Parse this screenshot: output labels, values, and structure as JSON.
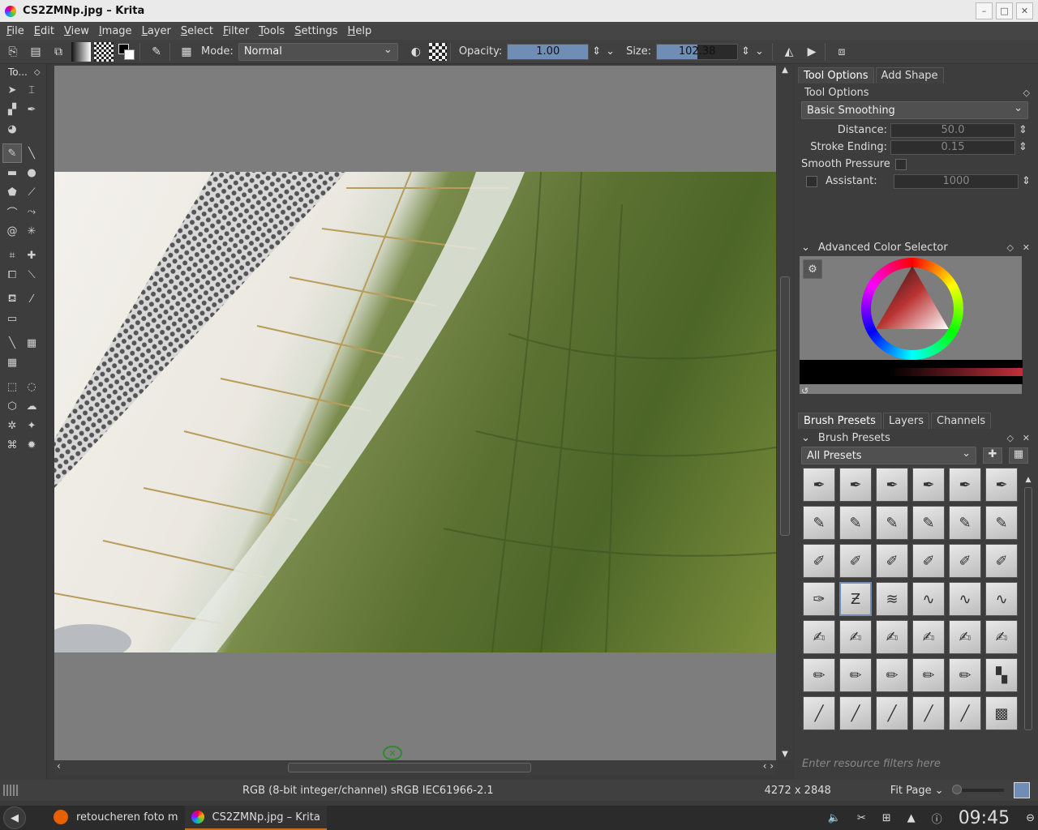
{
  "window": {
    "title": "CS2ZMNp.jpg – Krita",
    "minimize": "–",
    "maximize": "□",
    "close": "✕"
  },
  "menu": [
    "File",
    "Edit",
    "View",
    "Image",
    "Layer",
    "Select",
    "Filter",
    "Tools",
    "Settings",
    "Help"
  ],
  "toolbar": {
    "mode_label": "Mode:",
    "mode_value": "Normal",
    "opacity_label": "Opacity:",
    "opacity_value": "1.00",
    "opacity_fraction": 1.0,
    "size_label": "Size:",
    "size_value": "102.38",
    "size_fraction": 0.5
  },
  "toolbox": {
    "title": "To..."
  },
  "right_panel": {
    "tabs_top": [
      "Tool Options",
      "Add Shape"
    ],
    "tool_options": {
      "title": "Tool Options",
      "smoothing": "Basic Smoothing",
      "distance_label": "Distance:",
      "distance_value": "50.0",
      "stroke_ending_label": "Stroke Ending:",
      "stroke_ending_value": "0.15",
      "smooth_pressure_label": "Smooth Pressure",
      "assistant_label": "Assistant:",
      "assistant_value": "1000"
    },
    "color_selector": {
      "title": "Advanced Color Selector"
    },
    "tabs_bottom": [
      "Brush Presets",
      "Layers",
      "Channels"
    ],
    "brush_presets": {
      "title": "Brush Presets",
      "filter_value": "All Presets",
      "filter_placeholder": "Enter resource filters here"
    }
  },
  "status": {
    "color_space": "RGB (8-bit integer/channel)  sRGB IEC61966-2.1",
    "dimensions": "4272 x 2848",
    "zoom": "Fit Page"
  },
  "taskbar": {
    "tasks": [
      "retoucheren foto m",
      "CS2ZMNp.jpg – Krita"
    ],
    "clock": "09:45"
  },
  "colors": {
    "accent": "#6f8db5",
    "task_active": "#c07020"
  }
}
